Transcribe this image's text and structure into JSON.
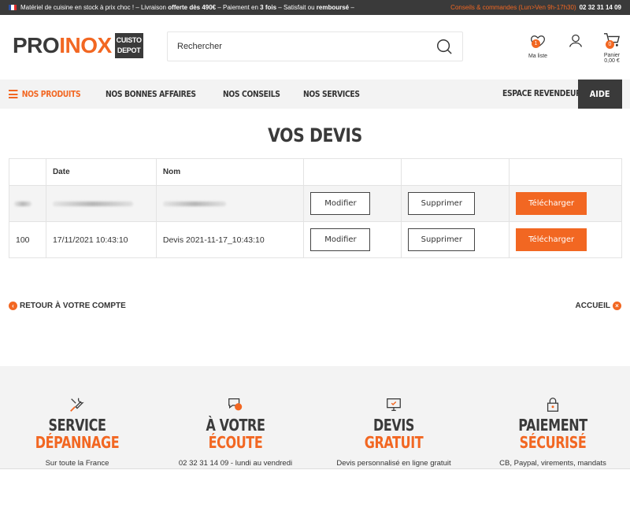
{
  "topbar": {
    "msg_start": "Matériel de cuisine en stock à prix choc ! – Livraison ",
    "msg_bold1": "offerte dès 490€",
    "msg_mid1": " – Paiement en ",
    "msg_bold2": "3 fois",
    "msg_mid2": " – Satisfait ou ",
    "msg_bold3": "remboursé",
    "msg_end": " –",
    "contact_label": "Conseils & commandes (Lun>Ven 9h-17h30)",
    "phone": "02 32 31 14 09"
  },
  "header": {
    "logo_part1": "PRO",
    "logo_part2": "INOX",
    "logo_badge_line1": "CUISTO",
    "logo_badge_line2": "DEPOT",
    "search_placeholder": "Rechercher",
    "wishlist_label": "Ma liste",
    "wishlist_count": "1",
    "cart_label": "Panier",
    "cart_count": "0",
    "cart_total": "0,00 €"
  },
  "nav": {
    "products": "Nos produits",
    "deals": "Nos bonnes affaires",
    "advice": "Nos conseils",
    "services": "Nos services",
    "reseller": "Espace revendeur",
    "help": "Aide"
  },
  "main": {
    "title": "VOS DEVIS",
    "table": {
      "headers": [
        "",
        "Date",
        "Nom",
        "",
        "",
        ""
      ],
      "rows": [
        {
          "id": "",
          "date": "",
          "name": "",
          "modify": "Modifier",
          "delete": "Supprimer",
          "download": "Télécharger"
        },
        {
          "id": "100",
          "date": "17/11/2021 10:43:10",
          "name": "Devis 2021-11-17_10:43:10",
          "modify": "Modifier",
          "delete": "Supprimer",
          "download": "Télécharger"
        }
      ]
    },
    "back_link": "RETOUR À VOTRE COMPTE",
    "home_link": "ACCUEIL"
  },
  "footer": {
    "features": [
      {
        "line1": "SERVICE",
        "line2": "DÉPANNAGE",
        "sub": "Sur toute la France",
        "icon": "wrench-icon"
      },
      {
        "line1": "À VOTRE",
        "line2": "ÉCOUTE",
        "sub": "02 32 31 14 09 - lundi au vendredi",
        "icon": "chat-icon"
      },
      {
        "line1": "DEVIS",
        "line2": "GRATUIT",
        "sub": "Devis personnalisé en ligne gratuit",
        "icon": "monitor-icon"
      },
      {
        "line1": "PAIEMENT",
        "line2": "SÉCURISÉ",
        "sub": "CB, Paypal, virements, mandats",
        "icon": "lock-icon"
      }
    ]
  },
  "colors": {
    "accent": "#f26722",
    "dark": "#3a3a3a"
  }
}
